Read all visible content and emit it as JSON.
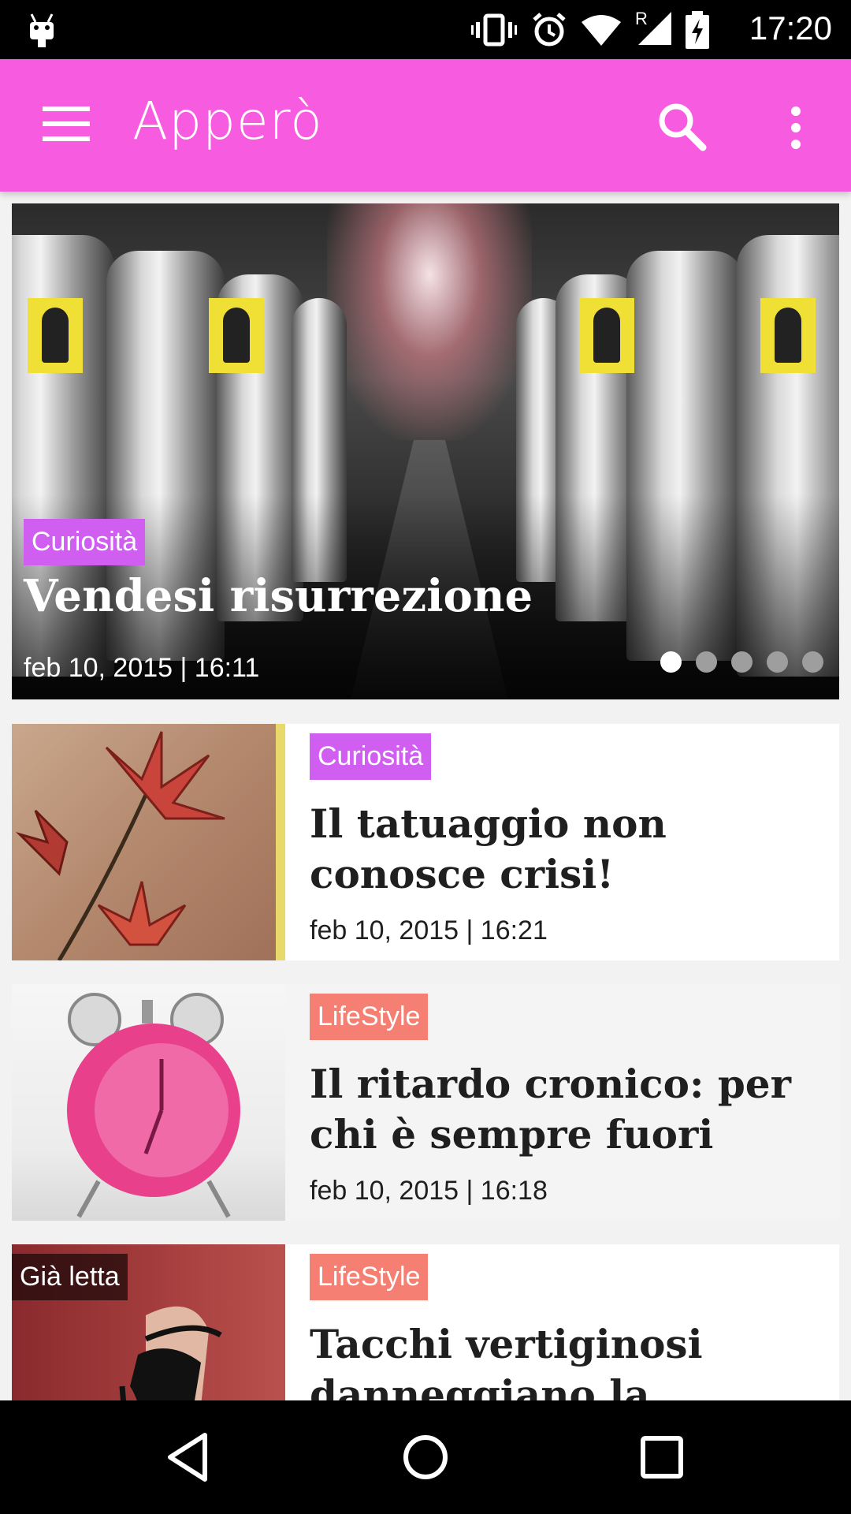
{
  "status_bar": {
    "time": "17:20",
    "network_label": "R"
  },
  "app_bar": {
    "title": "Apperò"
  },
  "featured": {
    "category": "Curiosità",
    "title": "Vendesi risurrezione",
    "date": "feb 10, 2015 | 16:11",
    "slide_count": 5,
    "active_slide": 1
  },
  "articles": [
    {
      "category": "Curiosità",
      "title": "Il tatuaggio non conosce crisi!",
      "date": "feb 10, 2015 | 16:21",
      "read_badge": ""
    },
    {
      "category": "LifeStyle",
      "title": "Il ritardo cronico: per chi è sempre fuori",
      "date": "feb 10, 2015 | 16:18",
      "read_badge": ""
    },
    {
      "category": "LifeStyle",
      "title": "Tacchi vertiginosi danneggiano la",
      "date": "",
      "read_badge": "Già letta"
    }
  ],
  "colors": {
    "app_bar": "#f75ce0",
    "tag_curiosita": "#d05ef0",
    "tag_lifestyle": "#f47f72"
  }
}
